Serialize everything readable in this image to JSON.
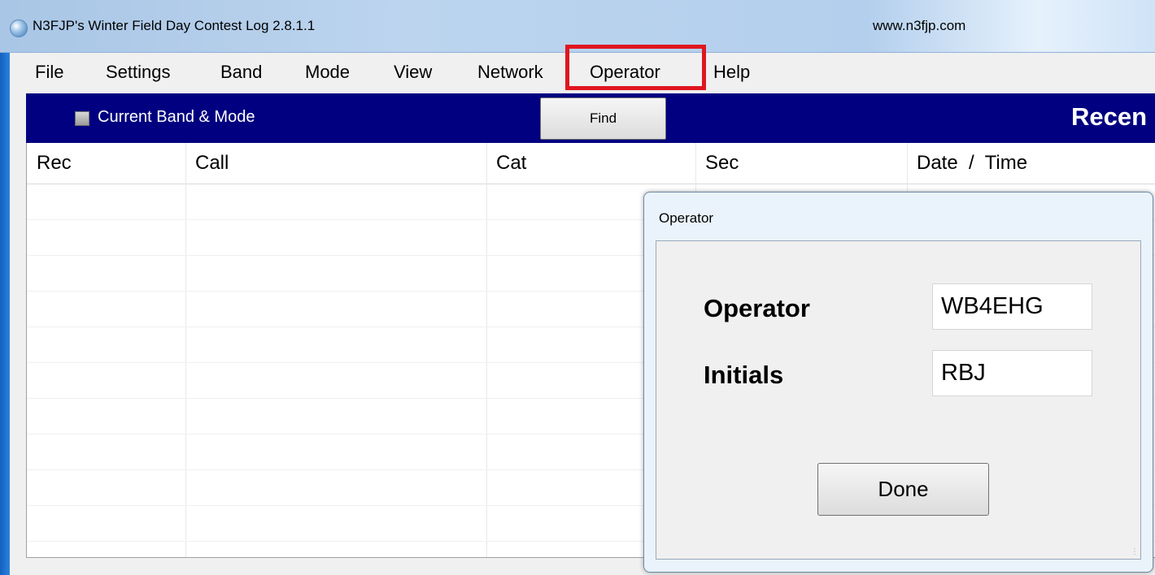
{
  "window": {
    "title": "N3FJP's Winter Field Day Contest Log 2.8.1.1",
    "url": "www.n3fjp.com"
  },
  "menu": {
    "items": [
      "File",
      "Settings",
      "Band",
      "Mode",
      "View",
      "Network",
      "Operator",
      "Help"
    ],
    "highlighted": "Operator"
  },
  "toolbar": {
    "checkbox_label": "Current Band & Mode",
    "checkbox_checked": false,
    "find_label": "Find",
    "recent_label": "Recen"
  },
  "table": {
    "columns": [
      "Rec",
      "Call",
      "Cat",
      "Sec",
      "Date  /  Time"
    ],
    "rows": []
  },
  "dialog": {
    "title": "Operator",
    "operator_label": "Operator",
    "operator_value": "WB4EHG",
    "initials_label": "Initials",
    "initials_value": "RBJ",
    "done_label": "Done"
  },
  "colors": {
    "toolbar_bg": "#000080",
    "highlight": "#e0161f",
    "desktop": "#1a6fcf"
  },
  "icons": {
    "app": "globe-icon",
    "grip": "resize-grip-icon"
  }
}
